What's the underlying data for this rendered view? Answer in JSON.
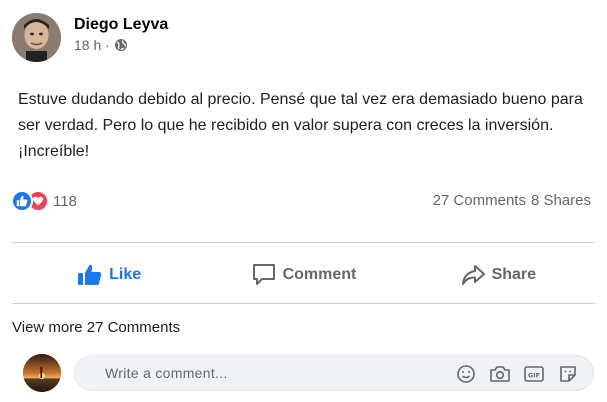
{
  "post": {
    "author": "Diego Leyva",
    "time": "18 h ·",
    "audience_icon": "globe-icon",
    "text": "Estuve dudando debido al precio. Pensé que tal vez era demasiado bueno para ser verdad. Pero lo que he recibido en valor supera con creces la inversión. ¡Increíble!"
  },
  "reactions": {
    "icons": [
      "like-reaction-icon",
      "love-reaction-icon"
    ],
    "count": "118",
    "comments": "27 Comments",
    "shares": "8 Shares"
  },
  "actions": {
    "like": "Like",
    "comment": "Comment",
    "share": "Share"
  },
  "comments": {
    "view_more": "View more 27 Comments",
    "placeholder": "Write a comment...",
    "tools": [
      "emoji-icon",
      "camera-icon",
      "gif-icon",
      "sticker-icon"
    ]
  },
  "colors": {
    "accent": "#1877f2",
    "love": "#f33e58",
    "muted": "#65676b"
  }
}
